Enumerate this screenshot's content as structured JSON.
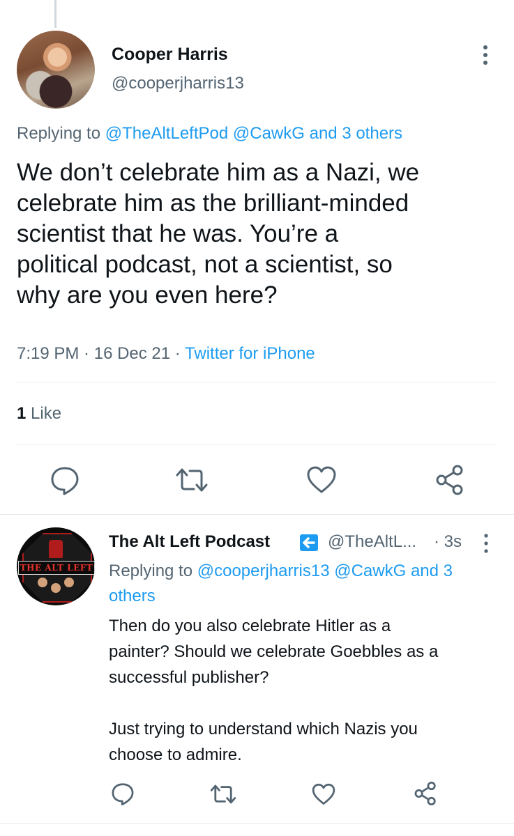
{
  "main_tweet": {
    "author_name": "Cooper Harris",
    "author_handle": "@cooperjharris13",
    "replying_prefix": "Replying to ",
    "replying_user1": "@TheAltLeftPod",
    "replying_user2": "@CawkG",
    "replying_others": "and 3 others",
    "text": "We don’t celebrate him as a Nazi, we\ncelebrate him as the brilliant-minded\nscientist that he was. You’re a\npolitical podcast, not a scientist, so\nwhy are you even here?",
    "time": "7:19 PM",
    "date": "16 Dec 21",
    "separator": " · ",
    "source": "Twitter for iPhone",
    "like_count": "1",
    "like_label": "Like"
  },
  "reply_tweet": {
    "author_name": "The Alt Left Podcast",
    "author_handle": "@TheAltL...",
    "time": "· 3s",
    "replying_prefix": "Replying to ",
    "replying_user1": "@cooperjharris13",
    "replying_user2": "@CawkG",
    "replying_others": "and 3 others",
    "avatar_text": "THE ALT LEFT",
    "text": "Then do you also celebrate Hitler as a\npainter? Should we celebrate Goebbles as a\nsuccessful publisher?\n\nJust trying to understand which Nazis you\nchoose to admire."
  },
  "icons": {
    "reply": "reply-icon",
    "retweet": "retweet-icon",
    "like": "heart-icon",
    "share": "share-icon",
    "more": "more-icon",
    "badge": "arrow-badge-icon"
  },
  "colors": {
    "link": "#1d9bf0",
    "secondary_text": "#536471",
    "primary_text": "#0f1419",
    "divider": "#e6ecf0",
    "icon": "#536471"
  }
}
